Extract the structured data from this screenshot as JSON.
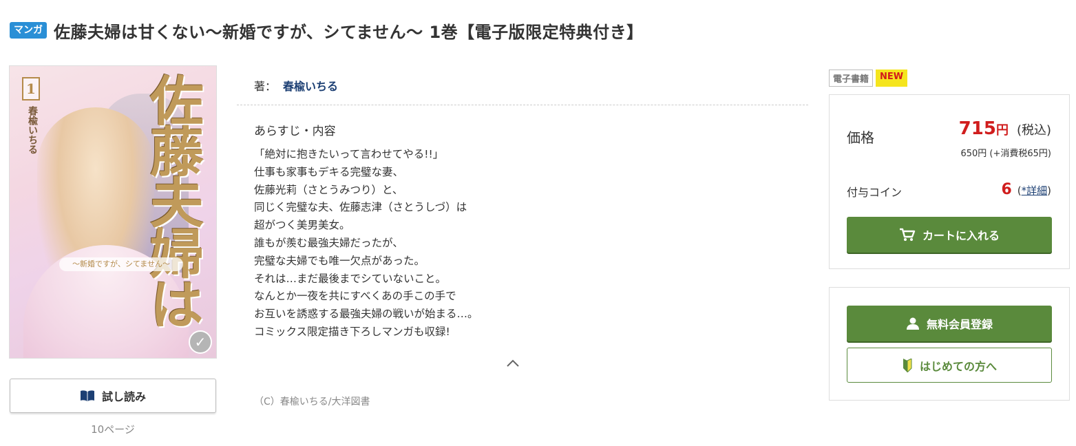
{
  "header": {
    "genre_badge": "マンガ",
    "title": "佐藤夫婦は甘くない〜新婚ですが、シてません〜 1巻【電子版限定特典付き】"
  },
  "cover": {
    "volume_number": "1",
    "author_vertical": "春楡いちる",
    "title_vertical": "佐藤夫婦は",
    "subtitle_banner": "〜新婚ですが、シてません〜"
  },
  "trial": {
    "button_label": "試し読み",
    "pages": "10ページ"
  },
  "author": {
    "label": "著：",
    "name": "春楡いちる"
  },
  "synopsis": {
    "heading": "あらすじ・内容",
    "lines": [
      "「絶対に抱きたいって言わせてやる!!」",
      "仕事も家事もデキる完璧な妻、",
      "佐藤光莉（さとうみつり）と、",
      "同じく完璧な夫、佐藤志津（さとうしづ）は",
      "超がつく美男美女。",
      "誰もが羨む最強夫婦だったが、",
      "完璧な夫婦でも唯一欠点があった。",
      "それは…まだ最後までシていないこと。",
      "なんとか一夜を共にすべくあの手この手で",
      "お互いを誘惑する最強夫婦の戦いが始まる…。",
      "コミックス限定描き下ろしマンガも収録!"
    ]
  },
  "copyright": "（C）春楡いちる/大洋図書",
  "tags": {
    "format": "電子書籍",
    "new": "NEW"
  },
  "price": {
    "label": "価格",
    "amount": "715",
    "currency": "円",
    "tax_note": "(税込)",
    "breakdown": "650円 (+消費税65円)"
  },
  "coin": {
    "label": "付与コイン",
    "amount": "6",
    "open_paren": "(",
    "detail_link": "*詳細",
    "close_paren": ")"
  },
  "buttons": {
    "cart": "カートに入れる",
    "register": "無料会員登録",
    "first_time": "はじめての方へ"
  },
  "colors": {
    "accent_green": "#5a8a3c",
    "price_red": "#d01d1d",
    "badge_blue": "#2a8fd6",
    "link_navy": "#1c3f73",
    "new_yellow": "#f5e51e"
  }
}
